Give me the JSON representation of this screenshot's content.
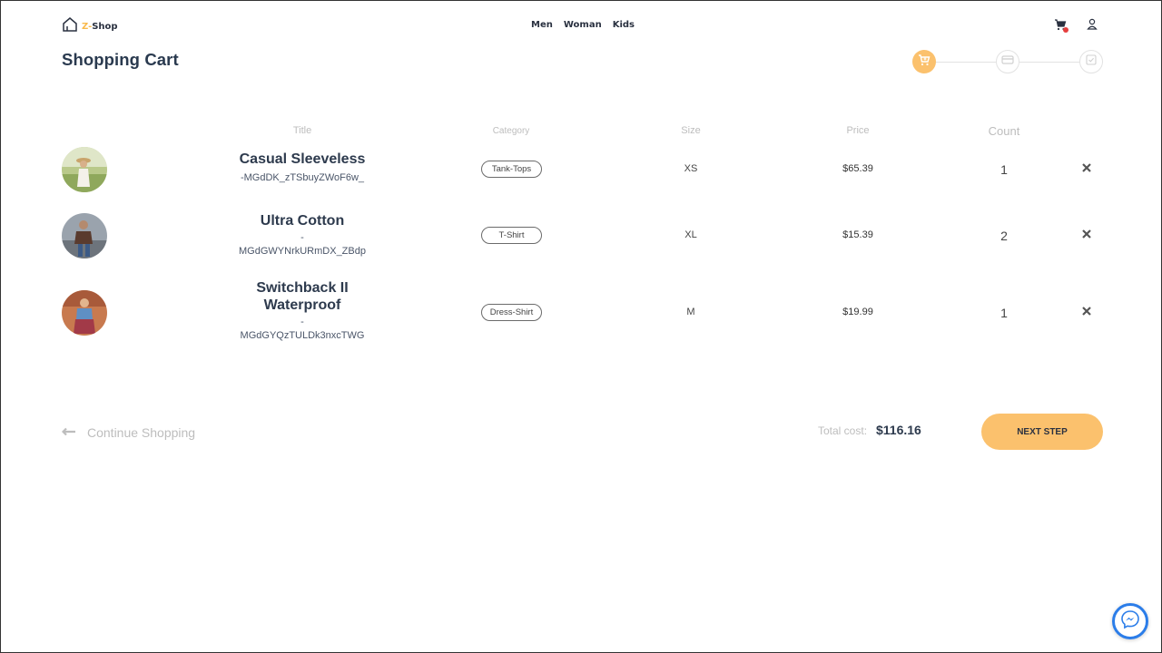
{
  "brand": {
    "name": "Z-Shop",
    "prefix": "Z-",
    "suffix": "Shop",
    "accent": "#fbc16d"
  },
  "nav": {
    "items": [
      "Men",
      "Woman",
      "Kids"
    ]
  },
  "header": {
    "cart_icon": "cart-icon",
    "cart_has_notification": true,
    "user_icon": "user-icon"
  },
  "page": {
    "title": "Shopping Cart"
  },
  "stepper": {
    "steps": [
      "cart",
      "payment",
      "confirm"
    ],
    "active": 0
  },
  "table": {
    "headers": {
      "title": "Title",
      "category": "Category",
      "size": "Size",
      "price": "Price",
      "count": "Count"
    },
    "rows": [
      {
        "title": "Casual Sleeveless",
        "id": "-MGdDK_zTSbuyZWoF6w_",
        "category": "Tank-Tops",
        "size": "XS",
        "price": "$65.39",
        "count": "1"
      },
      {
        "title": "Ultra Cotton",
        "id_dash": "-",
        "id": "MGdGWYNrkURmDX_ZBdp",
        "category": "T-Shirt",
        "size": "XL",
        "price": "$15.39",
        "count": "2"
      },
      {
        "title_line1": "Switchback II",
        "title_line2": "Waterproof",
        "id_dash": "-",
        "id": "MGdGYQzTULDk3nxcTWG",
        "category": "Dress-Shirt",
        "size": "M",
        "price": "$19.99",
        "count": "1"
      }
    ]
  },
  "footer": {
    "continue_label": "Continue Shopping",
    "total_label": "Total cost:",
    "total_value": "$116.16",
    "next_label": "NEXT STEP"
  },
  "colors": {
    "accent": "#fbc16d",
    "notification": "#e53e3e",
    "messenger": "#2b7de9"
  }
}
